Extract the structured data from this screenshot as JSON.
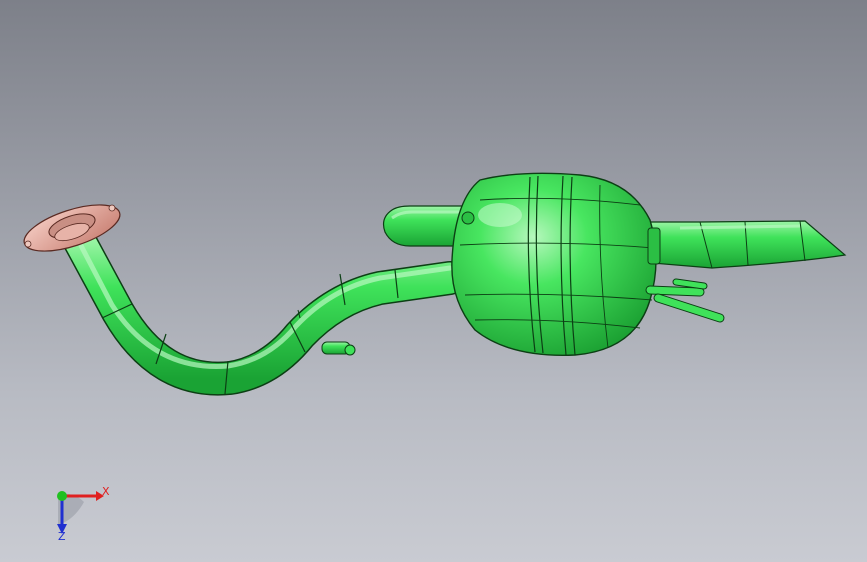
{
  "viewport": {
    "colors": {
      "background_top": "#7d8089",
      "background_bottom": "#c9cbd2",
      "part": "#35d84f",
      "flange": "#e4a79c"
    }
  },
  "model": {
    "parts": [
      "flange",
      "inlet-pipe",
      "muffler",
      "outlet-tailpipe",
      "side-pipe"
    ]
  },
  "triad": {
    "x_label": "X",
    "y_label": "",
    "z_label": "Z",
    "colors": {
      "x": "#e02020",
      "y": "#20c020",
      "z": "#2030d0"
    }
  }
}
